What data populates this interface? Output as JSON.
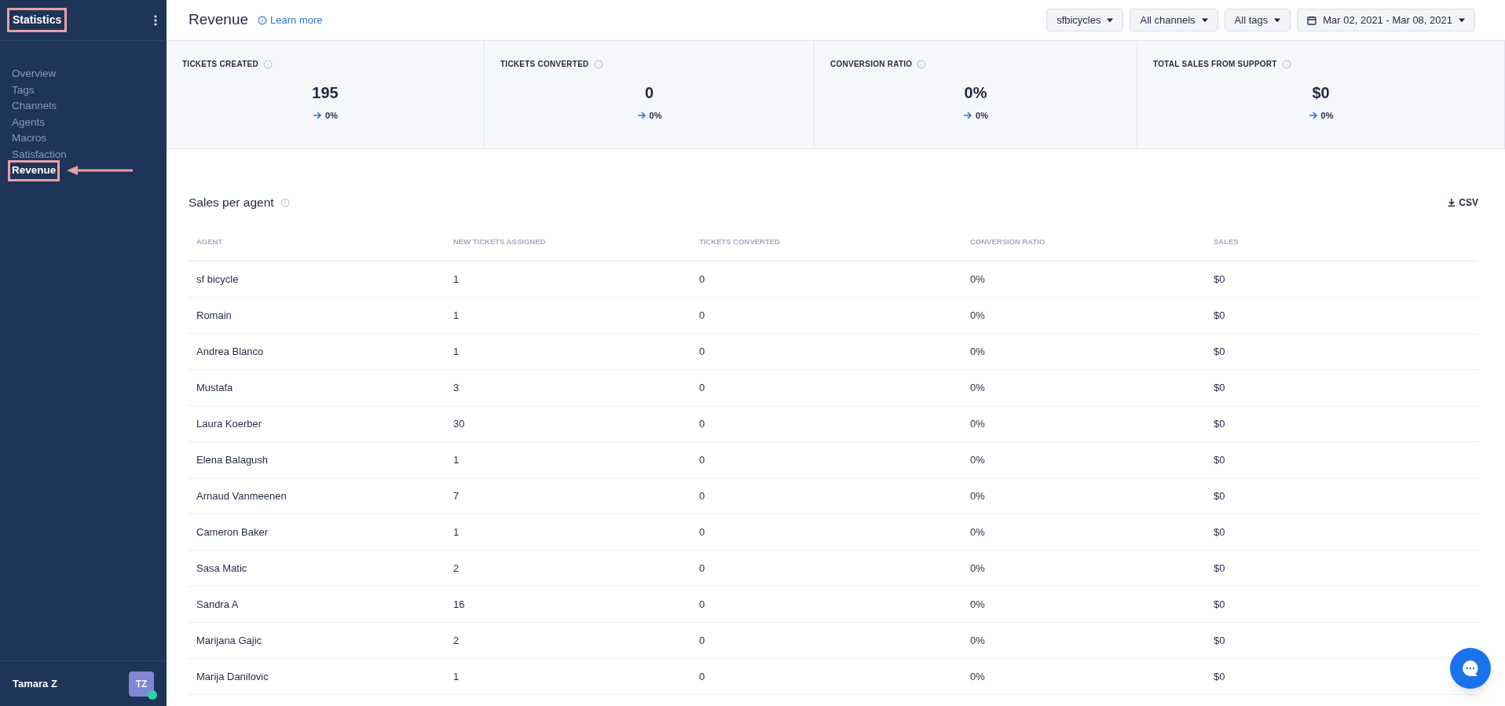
{
  "sidebar": {
    "title": {
      "text": "Statistics",
      "highlighted": true
    },
    "items": [
      {
        "label": "Overview",
        "selected": false
      },
      {
        "label": "Tags",
        "selected": false
      },
      {
        "label": "Channels",
        "selected": false
      },
      {
        "label": "Agents",
        "selected": false
      },
      {
        "label": "Macros",
        "selected": false
      },
      {
        "label": "Satisfaction",
        "selected": false
      },
      {
        "label": "Revenue",
        "selected": true
      }
    ],
    "user": {
      "name": "Tamara Z",
      "initials": "TZ",
      "online": true
    }
  },
  "header": {
    "title": "Revenue",
    "link": "Learn more",
    "filters": [
      {
        "label": "sfbicycles",
        "kind": "dropdown"
      },
      {
        "label": "All channels",
        "kind": "dropdown"
      },
      {
        "label": "All tags",
        "kind": "dropdown"
      },
      {
        "label": "Mar 02, 2021 - Mar 08, 2021",
        "kind": "date"
      }
    ]
  },
  "stats": [
    {
      "label": "TICKETS CREATED",
      "value": "195",
      "change": "0%"
    },
    {
      "label": "TICKETS CONVERTED",
      "value": "0",
      "change": "0%"
    },
    {
      "label": "CONVERSION RATIO",
      "value": "0%",
      "change": "0%"
    },
    {
      "label": "TOTAL SALES FROM SUPPORT",
      "value": "$0",
      "change": "0%"
    }
  ],
  "table": {
    "title": "Sales per agent",
    "export": "CSV",
    "columns": [
      "AGENT",
      "NEW TICKETS ASSIGNED",
      "TICKETS CONVERTED",
      "CONVERSION RATIO",
      "SALES"
    ],
    "rows": [
      [
        "sf bicycle",
        "1",
        "0",
        "0%",
        "$0"
      ],
      [
        "Romain",
        "1",
        "0",
        "0%",
        "$0"
      ],
      [
        "Andrea Blanco",
        "1",
        "0",
        "0%",
        "$0"
      ],
      [
        "Mustafa",
        "3",
        "0",
        "0%",
        "$0"
      ],
      [
        "Laura Koerber",
        "30",
        "0",
        "0%",
        "$0"
      ],
      [
        "Elena Balagush",
        "1",
        "0",
        "0%",
        "$0"
      ],
      [
        "Arnaud Vanmeenen",
        "7",
        "0",
        "0%",
        "$0"
      ],
      [
        "Cameron Baker",
        "1",
        "0",
        "0%",
        "$0"
      ],
      [
        "Sasa Matic",
        "2",
        "0",
        "0%",
        "$0"
      ],
      [
        "Sandra A",
        "16",
        "0",
        "0%",
        "$0"
      ],
      [
        "Marijana Gajic",
        "2",
        "0",
        "0%",
        "$0"
      ],
      [
        "Marija Danilovic",
        "1",
        "0",
        "0%",
        "$0"
      ]
    ]
  }
}
